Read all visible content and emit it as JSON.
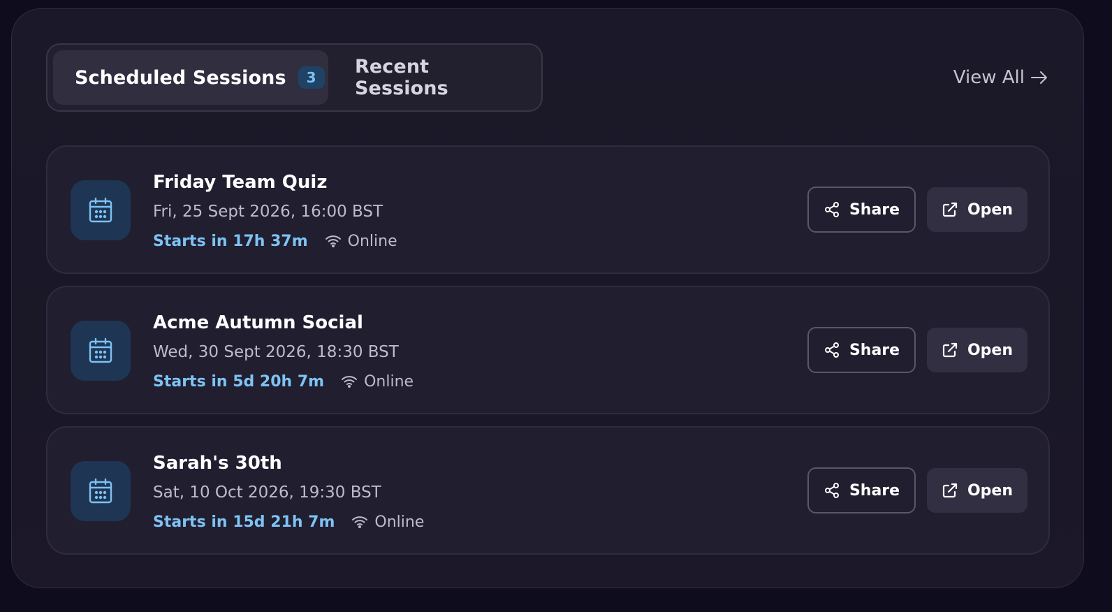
{
  "tabs": {
    "scheduled_label": "Scheduled Sessions",
    "scheduled_count": "3",
    "recent_label": "Recent Sessions"
  },
  "header": {
    "view_all_label": "View All",
    "view_all_icon": "arrow-right-icon"
  },
  "sessions": [
    {
      "title": "Friday Team Quiz",
      "date": "Fri, 25 Sept 2026, 16:00 BST",
      "countdown": "Starts in 17h 37m",
      "mode": "Online",
      "share_label": "Share",
      "open_label": "Open"
    },
    {
      "title": "Acme Autumn Social",
      "date": "Wed, 30 Sept 2026, 18:30 BST",
      "countdown": "Starts in 5d 20h 7m",
      "mode": "Online",
      "share_label": "Share",
      "open_label": "Open"
    },
    {
      "title": "Sarah's 30th",
      "date": "Sat, 10 Oct 2026, 19:30 BST",
      "countdown": "Starts in 15d 21h 7m",
      "mode": "Online",
      "share_label": "Share",
      "open_label": "Open"
    }
  ],
  "icons": {
    "session": "calendar-icon",
    "mode": "wifi-icon",
    "share": "share-icon",
    "open": "external-link-icon"
  },
  "colors": {
    "background": "#0f0c1d",
    "panel": "#1b1829",
    "card": "#211e30",
    "accent": "#7ec3f3",
    "badge_bg": "#1f4364",
    "calendar_tile": "#1e3554",
    "open_button": "#332f42"
  }
}
